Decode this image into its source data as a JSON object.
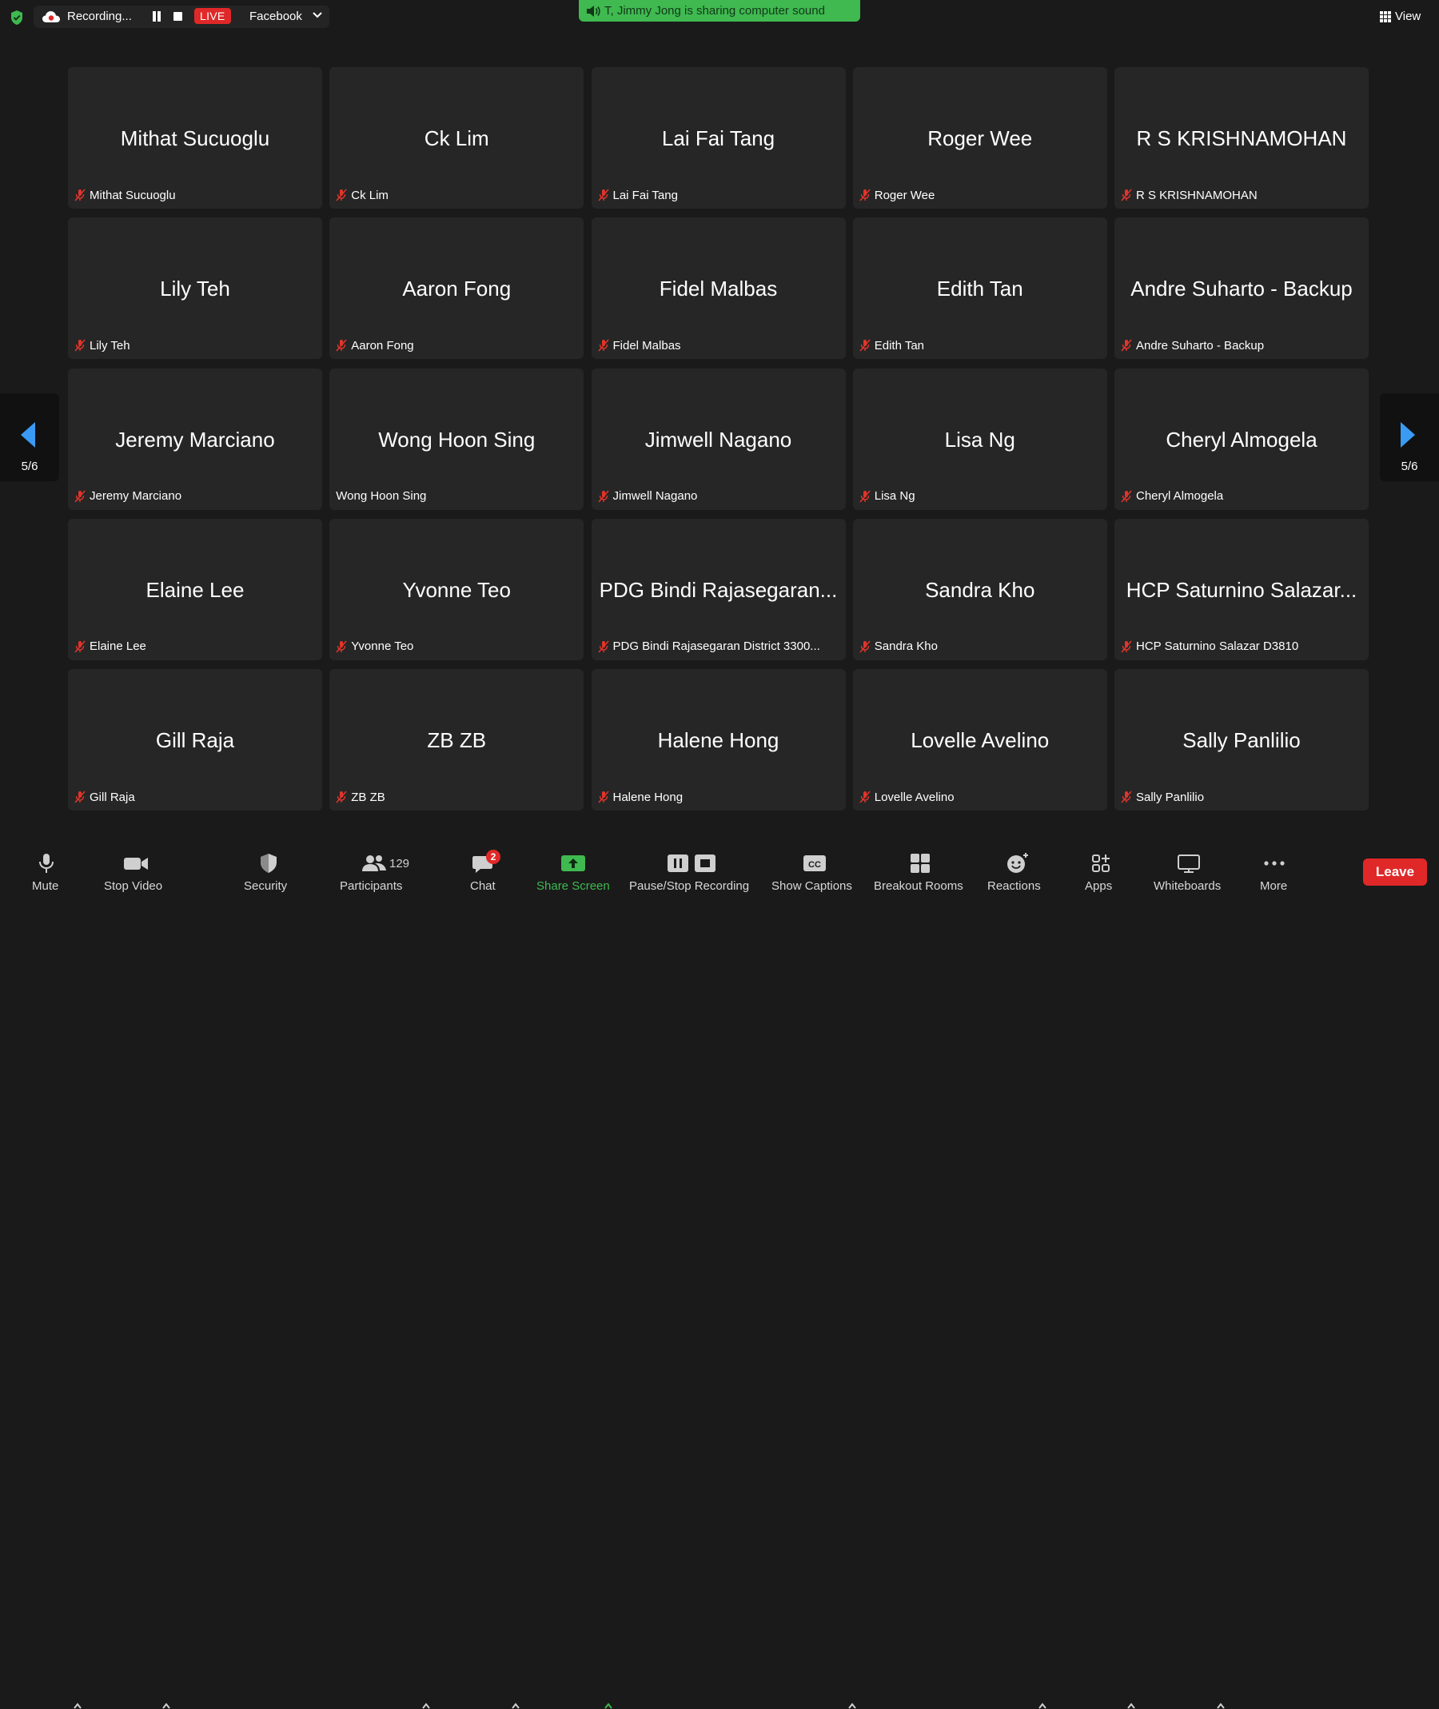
{
  "top_bar": {
    "recording_label": "Recording...",
    "live_label": "LIVE",
    "stream_target": "Facebook",
    "share_banner": "T, Jimmy Jong is sharing computer sound",
    "view_label": "View"
  },
  "gallery": {
    "page_indicator": "5/6",
    "tiles": [
      {
        "name": "Mithat Sucuoglu",
        "label": "Mithat Sucuoglu",
        "muted": true
      },
      {
        "name": "Ck Lim",
        "label": "Ck Lim",
        "muted": true
      },
      {
        "name": "Lai Fai Tang",
        "label": "Lai Fai Tang",
        "muted": true
      },
      {
        "name": "Roger Wee",
        "label": "Roger Wee",
        "muted": true
      },
      {
        "name": "R S KRISHNAMOHAN",
        "label": "R S KRISHNAMOHAN",
        "muted": true
      },
      {
        "name": "Lily Teh",
        "label": "Lily Teh",
        "muted": true
      },
      {
        "name": "Aaron Fong",
        "label": "Aaron Fong",
        "muted": true
      },
      {
        "name": "Fidel Malbas",
        "label": "Fidel Malbas",
        "muted": true
      },
      {
        "name": "Edith Tan",
        "label": "Edith Tan",
        "muted": true
      },
      {
        "name": "Andre Suharto - Backup",
        "label": "Andre Suharto - Backup",
        "muted": true
      },
      {
        "name": "Jeremy Marciano",
        "label": "Jeremy Marciano",
        "muted": true
      },
      {
        "name": "Wong Hoon Sing",
        "label": "Wong Hoon Sing",
        "muted": false
      },
      {
        "name": "Jimwell Nagano",
        "label": "Jimwell Nagano",
        "muted": true
      },
      {
        "name": "Lisa Ng",
        "label": "Lisa Ng",
        "muted": true
      },
      {
        "name": "Cheryl Almogela",
        "label": "Cheryl Almogela",
        "muted": true
      },
      {
        "name": "Elaine Lee",
        "label": "Elaine Lee",
        "muted": true
      },
      {
        "name": "Yvonne Teo",
        "label": "Yvonne Teo",
        "muted": true
      },
      {
        "name": "PDG Bindi Rajasegaran...",
        "label": "PDG Bindi Rajasegaran District 3300...",
        "muted": true
      },
      {
        "name": "Sandra Kho",
        "label": "Sandra Kho",
        "muted": true
      },
      {
        "name": "HCP Saturnino Salazar...",
        "label": "HCP Saturnino Salazar  D3810",
        "muted": true
      },
      {
        "name": "Gill Raja",
        "label": "Gill Raja",
        "muted": true
      },
      {
        "name": "ZB ZB",
        "label": "ZB ZB",
        "muted": true
      },
      {
        "name": "Halene Hong",
        "label": "Halene Hong",
        "muted": true
      },
      {
        "name": "Lovelle Avelino",
        "label": "Lovelle Avelino",
        "muted": true
      },
      {
        "name": "Sally Panlilio",
        "label": "Sally Panlilio",
        "muted": true
      }
    ]
  },
  "toolbar": {
    "mute_label": "Mute",
    "video_label": "Stop Video",
    "security_label": "Security",
    "participants_label": "Participants",
    "participants_count": "129",
    "chat_label": "Chat",
    "chat_badge": "2",
    "share_label": "Share Screen",
    "recording_label": "Pause/Stop Recording",
    "captions_label": "Show Captions",
    "breakout_label": "Breakout Rooms",
    "reactions_label": "Reactions",
    "apps_label": "Apps",
    "whiteboards_label": "Whiteboards",
    "more_label": "More",
    "leave_label": "Leave"
  },
  "colors": {
    "live_red": "#e02828",
    "share_green": "#3fb950",
    "nav_blue": "#3a9bf4",
    "tile_bg": "#262626",
    "muted_red": "#e0352b"
  }
}
